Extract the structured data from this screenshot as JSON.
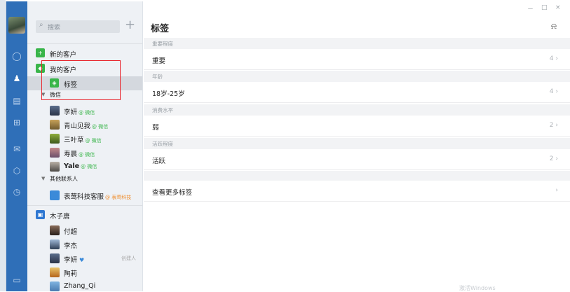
{
  "sidebar_rail": {
    "icons": [
      "chat-bubble-icon",
      "contacts-icon",
      "calendar-icon",
      "apps-grid-icon",
      "mail-icon",
      "settings-hex-icon",
      "clock-icon",
      "document-icon"
    ]
  },
  "contacts": {
    "search_placeholder": "搜索",
    "add_label": "+",
    "new_customers": "新的客户",
    "my_customers": "我的客户",
    "tags": "标签",
    "wechat_group": "微信",
    "wechat_contacts": [
      {
        "name": "李妍",
        "tag": "@ 微信"
      },
      {
        "name": "青山见我",
        "tag": "@ 微信"
      },
      {
        "name": "三叶草",
        "tag": "@ 微信"
      },
      {
        "name": "寿晨",
        "tag": "@ 微信"
      },
      {
        "name": "Yale",
        "tag": "@ 微信"
      }
    ],
    "other_group": "其他联系人",
    "other_contacts": [
      {
        "name": "表莺科技客服",
        "tag": "@ 表莺科技"
      }
    ],
    "org_name": "木子唐",
    "org_members": [
      {
        "name": "付超",
        "role": ""
      },
      {
        "name": "李杰",
        "role": ""
      },
      {
        "name": "李妍",
        "role": "创建人"
      },
      {
        "name": "陶莉",
        "role": ""
      },
      {
        "name": "Zhang_Qi",
        "role": ""
      }
    ]
  },
  "main": {
    "window_controls": [
      "－",
      "□",
      "×"
    ],
    "title": "标签",
    "sections": [
      {
        "header": "重要程度",
        "label": "重要",
        "count": "4"
      },
      {
        "header": "年龄",
        "label": "18岁-25岁",
        "count": "4"
      },
      {
        "header": "消费水平",
        "label": "弱",
        "count": "2"
      },
      {
        "header": "活跃程度",
        "label": "活跃",
        "count": "2"
      }
    ],
    "more_tags": "查看更多标签",
    "chevron": "›",
    "footer_hint": "激活Windows"
  },
  "colors": {
    "rail_blue": "#2f6fb8",
    "accent_green": "#39b54a",
    "highlight_red": "#e8262d",
    "org_orange": "#f08c2a"
  }
}
